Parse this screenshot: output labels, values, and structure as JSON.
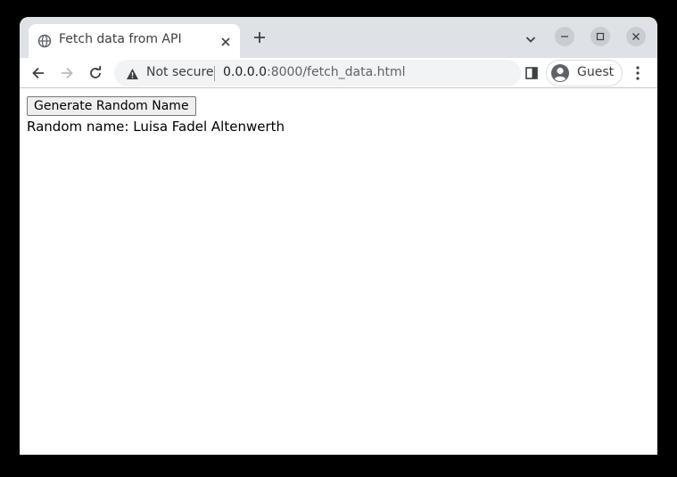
{
  "browser": {
    "tab": {
      "title": "Fetch data from API",
      "favicon": "globe-icon"
    },
    "address_bar": {
      "security_status": "Not secure",
      "url_host": "0.0.0.0",
      "url_rest": ":8000/fetch_data.html"
    },
    "profile": {
      "label": "Guest"
    }
  },
  "page": {
    "button_label": "Generate Random Name",
    "result_label": "Random name:",
    "result_value": "Luisa Fadel Altenwerth"
  },
  "colors": {
    "tab_strip": "#dee1e6",
    "omnibox": "#f1f3f4",
    "page_background": "#ffffff"
  }
}
